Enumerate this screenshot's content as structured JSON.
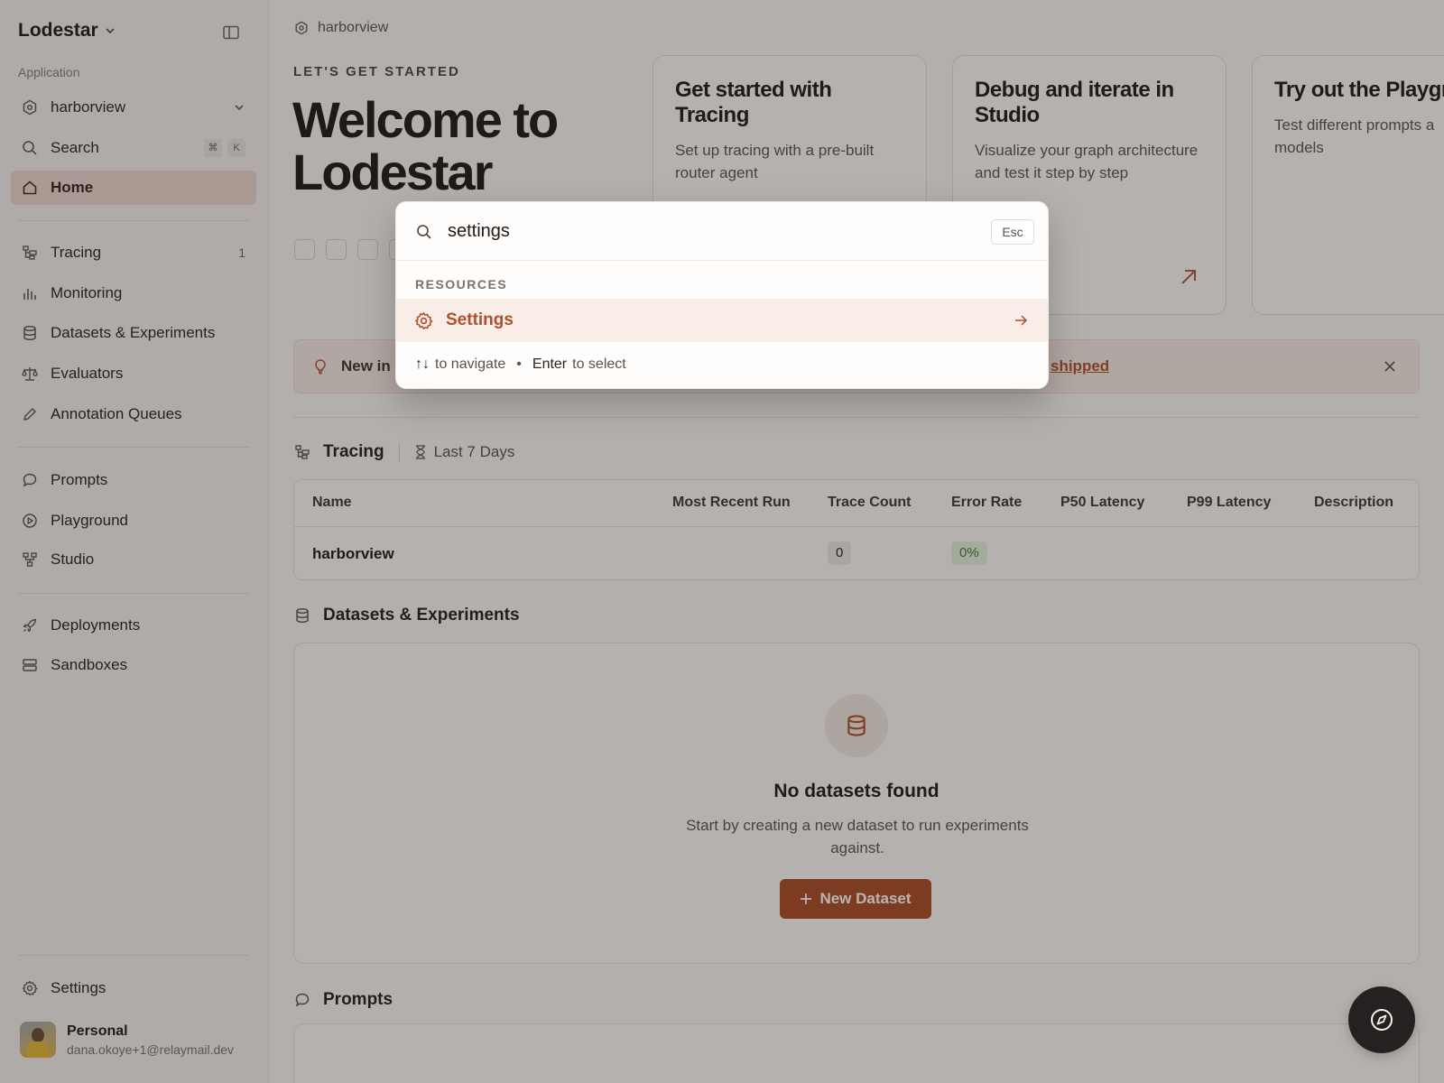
{
  "app": {
    "name": "Lodestar"
  },
  "sidebar": {
    "section_label": "Application",
    "project": "harborview",
    "search": {
      "label": "Search",
      "shortcut": [
        "⌘",
        "K"
      ]
    },
    "items": [
      {
        "label": "Home",
        "icon": "home-icon"
      },
      {
        "label": "Tracing",
        "icon": "tracing-icon",
        "count": "1"
      },
      {
        "label": "Monitoring",
        "icon": "bar-chart-icon"
      },
      {
        "label": "Datasets & Experiments",
        "icon": "database-icon"
      },
      {
        "label": "Evaluators",
        "icon": "scale-icon"
      },
      {
        "label": "Annotation Queues",
        "icon": "pencil-icon"
      },
      {
        "label": "Prompts",
        "icon": "chat-bubble-icon"
      },
      {
        "label": "Playground",
        "icon": "play-circle-icon"
      },
      {
        "label": "Studio",
        "icon": "graph-icon"
      },
      {
        "label": "Deployments",
        "icon": "rocket-icon"
      },
      {
        "label": "Sandboxes",
        "icon": "server-icon"
      }
    ],
    "settings": "Settings",
    "user": {
      "name": "Personal",
      "email": "dana.okoye+1@relaymail.dev"
    }
  },
  "main": {
    "breadcrumb": "harborview",
    "kicker": "LET'S GET STARTED",
    "welcome": "Welcome to Lodestar",
    "cards": [
      {
        "title": "Get started with Tracing",
        "text": "Set up tracing with a pre-built router agent"
      },
      {
        "title": "Debug and iterate in Studio",
        "text": "Visualize your graph architecture and test it step by step"
      },
      {
        "title": "Try out the Playgro",
        "text": "Test different prompts a models"
      }
    ],
    "banner": {
      "text": "New in",
      "link": "shipped"
    },
    "tracing": {
      "title": "Tracing",
      "range": "Last 7 Days",
      "columns": [
        "Name",
        "Most Recent Run",
        "Trace Count",
        "Error Rate",
        "P50 Latency",
        "P99 Latency",
        "Description"
      ],
      "rows": [
        {
          "name": "harborview",
          "trace_count": "0",
          "error_rate": "0%"
        }
      ]
    },
    "datasets": {
      "title": "Datasets & Experiments",
      "empty_title": "No datasets found",
      "empty_text": "Start by creating a new dataset to run experiments against.",
      "button": "New Dataset"
    },
    "prompts": {
      "title": "Prompts"
    }
  },
  "palette": {
    "query": "settings",
    "esc": "Esc",
    "group": "RESOURCES",
    "result": "Settings",
    "footer": {
      "nav_keys": "↑↓",
      "nav_text": "to navigate",
      "select_key": "Enter",
      "select_text": "to select"
    }
  },
  "colors": {
    "accent": "#b0502c",
    "button": "#a94a26",
    "success": "#3d7a3a"
  }
}
